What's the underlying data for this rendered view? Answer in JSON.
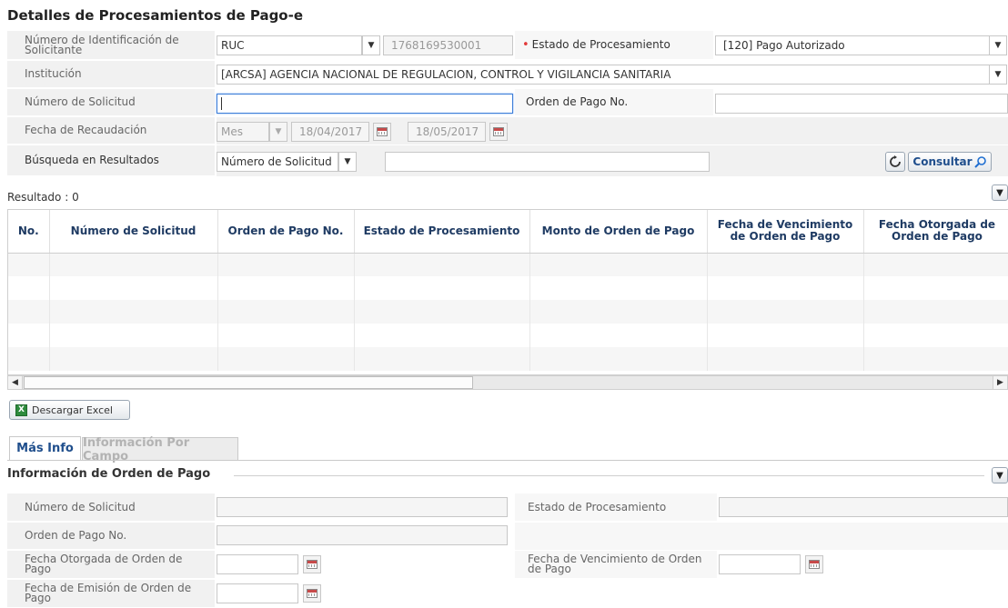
{
  "page": {
    "title": "Detalles de Procesamientos de Pago-e"
  },
  "form": {
    "id_label": "Número de Identificación de Solicitante",
    "id_type_value": "RUC",
    "id_number_value": "1768169530001",
    "estado_label": "Estado de Procesamiento",
    "estado_required_mark": "•",
    "estado_value": "[120] Pago Autorizado",
    "institucion_label": "Institución",
    "institucion_value": "[ARCSA] AGENCIA NACIONAL DE REGULACION, CONTROL Y VIGILANCIA SANITARIA",
    "num_solicitud_label": "Número de Solicitud",
    "num_solicitud_value": "",
    "orden_pago_label": "Orden de Pago No.",
    "orden_pago_value": "",
    "fecha_recaudacion_label": "Fecha de Recaudación",
    "periodo_value": "Mes",
    "fecha_desde": "18/04/2017",
    "fecha_hasta": "18/05/2017",
    "busqueda_label": "Búsqueda en Resultados",
    "busqueda_campo": "Número de Solicitud",
    "busqueda_texto": "",
    "consultar_label": "Consultar"
  },
  "results": {
    "label": "Resultado : 0",
    "columns": [
      "No.",
      "Número de Solicitud",
      "Orden de Pago No.",
      "Estado de Procesamiento",
      "Monto de Orden de Pago",
      "Fecha de Vencimiento de Orden de Pago",
      "Fecha Otorgada de Orden de Pago"
    ],
    "rows": []
  },
  "excel_button": {
    "label": "Descargar Excel"
  },
  "tabs": [
    {
      "label": "Más Info",
      "active": true
    },
    {
      "label": "Información Por Campo",
      "active": false
    }
  ],
  "detail": {
    "section_title": "Información de Orden de Pago",
    "num_solicitud_label": "Número de Solicitud",
    "estado_label": "Estado de Procesamiento",
    "orden_pago_label": "Orden de Pago No.",
    "fecha_otorgada_label": "Fecha Otorgada de Orden de Pago",
    "fecha_vencimiento_label": "Fecha de Vencimiento de Orden de Pago",
    "fecha_emision_label": "Fecha de Emisión de Orden de Pago"
  },
  "icons": {
    "dropdown": "chevron-down-icon",
    "calendar": "calendar-icon",
    "refresh": "refresh-icon",
    "search": "search-icon",
    "excel": "excel-icon",
    "collapse": "collapse-icon"
  },
  "colors": {
    "label_bg": "#f1f1f1",
    "grid_header_text": "#1f3b63",
    "tab_active_text": "#1f4e8c",
    "focus_border": "#3b7dd8",
    "required": "#e23b3b"
  }
}
